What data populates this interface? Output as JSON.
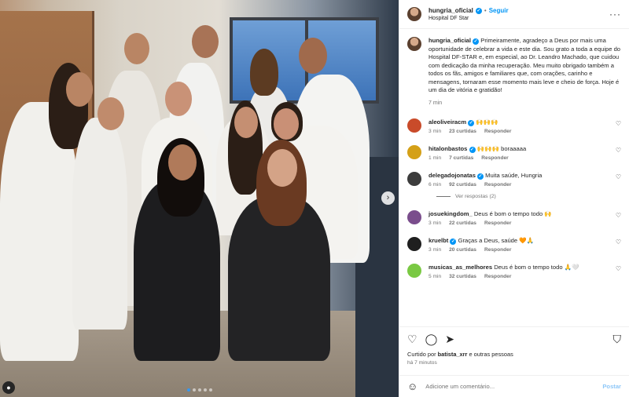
{
  "header": {
    "username": "hungria_oficial",
    "follow_label": "Seguir",
    "separator": "•",
    "location": "Hospital DF Star",
    "more": "···"
  },
  "caption": {
    "username": "hungria_oficial",
    "text": "Primeiramente, agradeço a Deus por mais uma oportunidade de celebrar a vida e este dia. Sou grato a toda a equipe do Hospital DF-STAR e, em especial, ao Dr. Leandro Machado, que cuidou com dedicação da minha recuperação. Meu muito obrigado também a todos os fãs, amigos e familiares que, com orações, carinho e mensagens, tornaram esse momento mais leve e cheio de força. Hoje é um dia de vitória e gratidão!",
    "time": "7 min"
  },
  "comments": [
    {
      "username": "aleoliveiracm",
      "verified": true,
      "text": "🙌🙌🙌",
      "time": "3 min",
      "likes": "23 curtidas",
      "reply": "Responder",
      "avatar_color": "#c94b2a"
    },
    {
      "username": "hitalonbastos",
      "verified": true,
      "text": "🙌🙌🙌 boraaaaa",
      "time": "1 min",
      "likes": "7 curtidas",
      "reply": "Responder",
      "avatar_color": "#d4a017"
    },
    {
      "username": "delegadojonatas",
      "verified": true,
      "text": "Muita saúde, Hungria",
      "time": "6 min",
      "likes": "92 curtidas",
      "reply": "Responder",
      "avatar_color": "#3c3c3c"
    },
    {
      "username": "josuekingdom_",
      "verified": false,
      "text": "Deus é bom o tempo todo 🙌",
      "time": "3 min",
      "likes": "22 curtidas",
      "reply": "Responder",
      "avatar_color": "#7a4d8c"
    },
    {
      "username": "kruelbt",
      "verified": true,
      "text": "Graças a Deus, saúde 🧡🙏",
      "time": "3 min",
      "likes": "20 curtidas",
      "reply": "Responder",
      "avatar_color": "#1f1f1f"
    },
    {
      "username": "musicas_as_melhores",
      "verified": false,
      "text": "Deus é bom o tempo todo 🙏🤍",
      "time": "5 min",
      "likes": "32 curtidas",
      "reply": "Responder",
      "avatar_color": "#7ac943"
    }
  ],
  "view_replies": "Ver respostas (2)",
  "liked_by": {
    "prefix": "Curtido por ",
    "user": "batista_xrr",
    "suffix": " e outras pessoas"
  },
  "post_age": "há 7 minutos",
  "add_comment": {
    "placeholder": "Adicione um comentário...",
    "post_label": "Postar"
  },
  "icons": {
    "like": "heart-icon",
    "comment": "comment-icon",
    "share": "share-icon",
    "save": "bookmark-icon",
    "emoji": "emoji-icon",
    "verified": "verified-badge-icon"
  },
  "carousel": {
    "slides": 5,
    "active": 1
  },
  "colors": {
    "accent": "#0095f6",
    "post_disabled": "#8ec7f8",
    "muted": "#737373"
  }
}
